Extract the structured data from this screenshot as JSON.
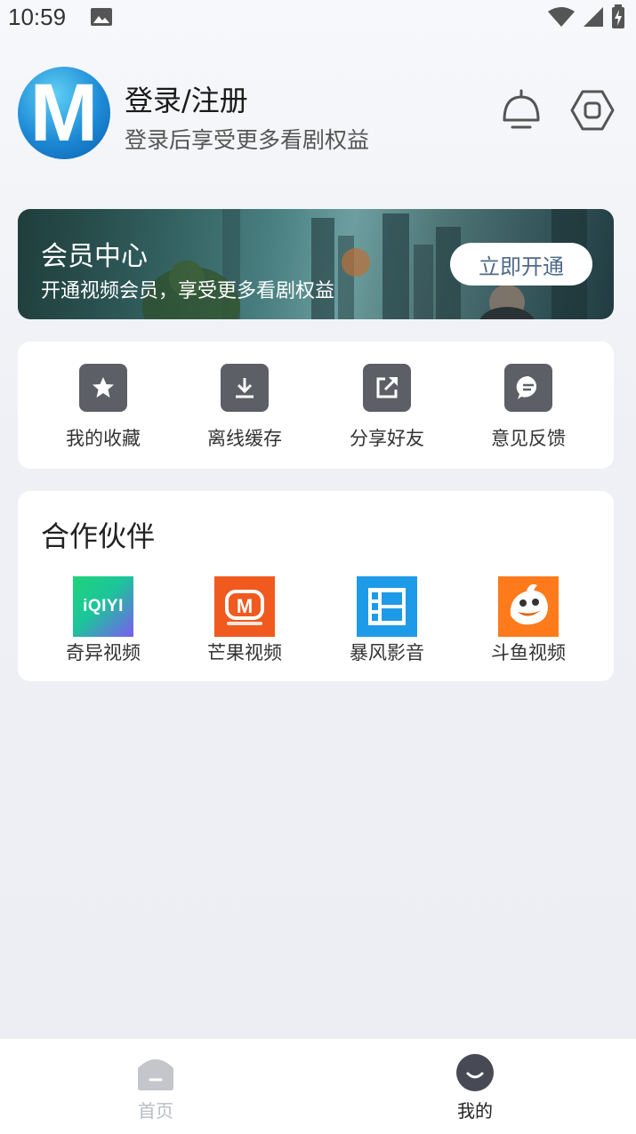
{
  "status_bar": {
    "time": "10:59",
    "icons": [
      "image-icon",
      "wifi-icon",
      "signal-icon",
      "battery-icon"
    ]
  },
  "profile": {
    "avatar_letter": "M",
    "title": "登录/注册",
    "subtitle": "登录后享受更多看剧权益",
    "actions": [
      "tv-icon",
      "settings-icon"
    ]
  },
  "vip": {
    "title": "会员中心",
    "subtitle": "开通视频会员，享受更多看剧权益",
    "button": "立即开通"
  },
  "quick_actions": [
    {
      "label": "我的收藏",
      "icon": "star-icon"
    },
    {
      "label": "离线缓存",
      "icon": "download-icon"
    },
    {
      "label": "分享好友",
      "icon": "share-icon"
    },
    {
      "label": "意见反馈",
      "icon": "feedback-icon"
    }
  ],
  "partners": {
    "title": "合作伙伴",
    "items": [
      {
        "label": "奇异视频",
        "logo_text": "iQIYI",
        "logo": "iqiyi-logo-icon"
      },
      {
        "label": "芒果视频",
        "logo_text": "M",
        "logo": "mango-logo-icon"
      },
      {
        "label": "暴风影音",
        "logo_text": "",
        "logo": "baofeng-logo-icon"
      },
      {
        "label": "斗鱼视频",
        "logo_text": "",
        "logo": "douyu-logo-icon"
      }
    ]
  },
  "bottom_nav": [
    {
      "label": "首页",
      "icon": "home-icon",
      "active": false
    },
    {
      "label": "我的",
      "icon": "profile-icon",
      "active": true
    }
  ],
  "colors": {
    "accent_dark": "#5d5f66",
    "vip_button_text": "#4f6a88",
    "nav_inactive": "#b9bcc3",
    "nav_active": "#222222"
  }
}
